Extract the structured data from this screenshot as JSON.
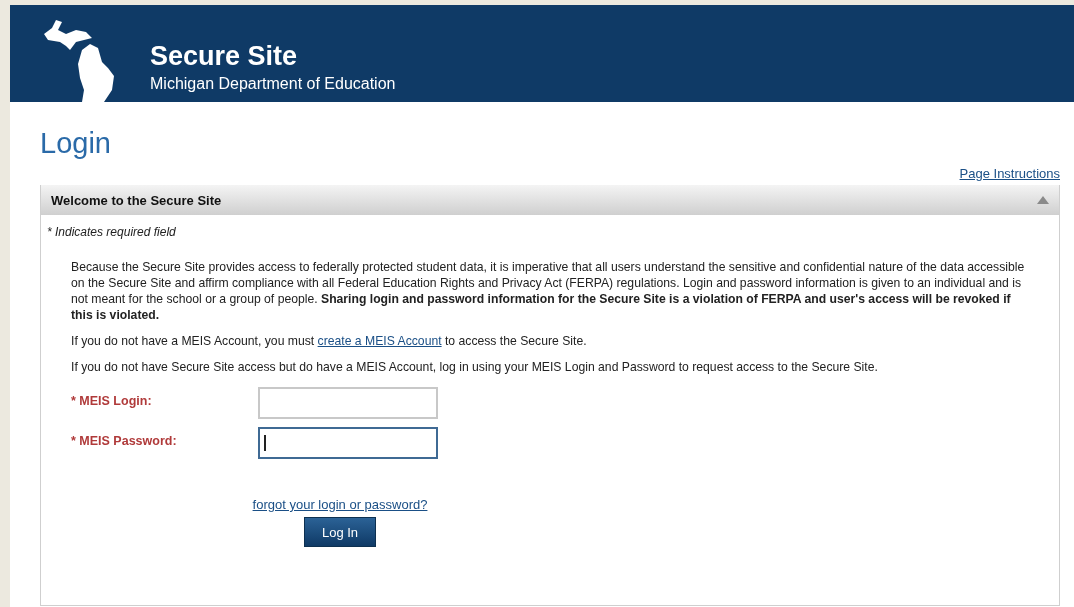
{
  "header": {
    "title": "Secure Site",
    "subtitle": "Michigan Department of Education"
  },
  "page_title": "Login",
  "page_instructions_link": "Page Instructions",
  "panel": {
    "title": "Welcome to the Secure Site",
    "expanded": true,
    "required_note": "* Indicates required field",
    "paragraphs": [
      {
        "kind": "text",
        "text": "Because the Secure Site provides access to federally protected student data, it is imperative that all users understand the sensitive and confidential nature of the data accessible on the Secure Site and affirm compliance with all Federal Education Rights and Privacy Act (FERPA) regulations. Login and password information is given to an individual and is not meant for the school or a group of people. **Sharing login and password information for the Secure Site is a violation of FERPA and user's access will be revoked if this is violated.**"
      },
      {
        "kind": "link",
        "before": "If you do not have a MEIS Account, you must ",
        "link": "create a MEIS Account",
        "after": " to access the Secure Site."
      },
      {
        "kind": "text",
        "text": "If you do not have Secure Site access but do have a MEIS Account, log in using your MEIS Login and Password to request access to the Secure Site."
      }
    ],
    "fields": [
      {
        "label": "* MEIS Login:",
        "focused": false
      },
      {
        "label": "* MEIS Password:",
        "focused": true
      }
    ],
    "forgot_link": "forgot your login or password?",
    "submit": "Log In"
  }
}
